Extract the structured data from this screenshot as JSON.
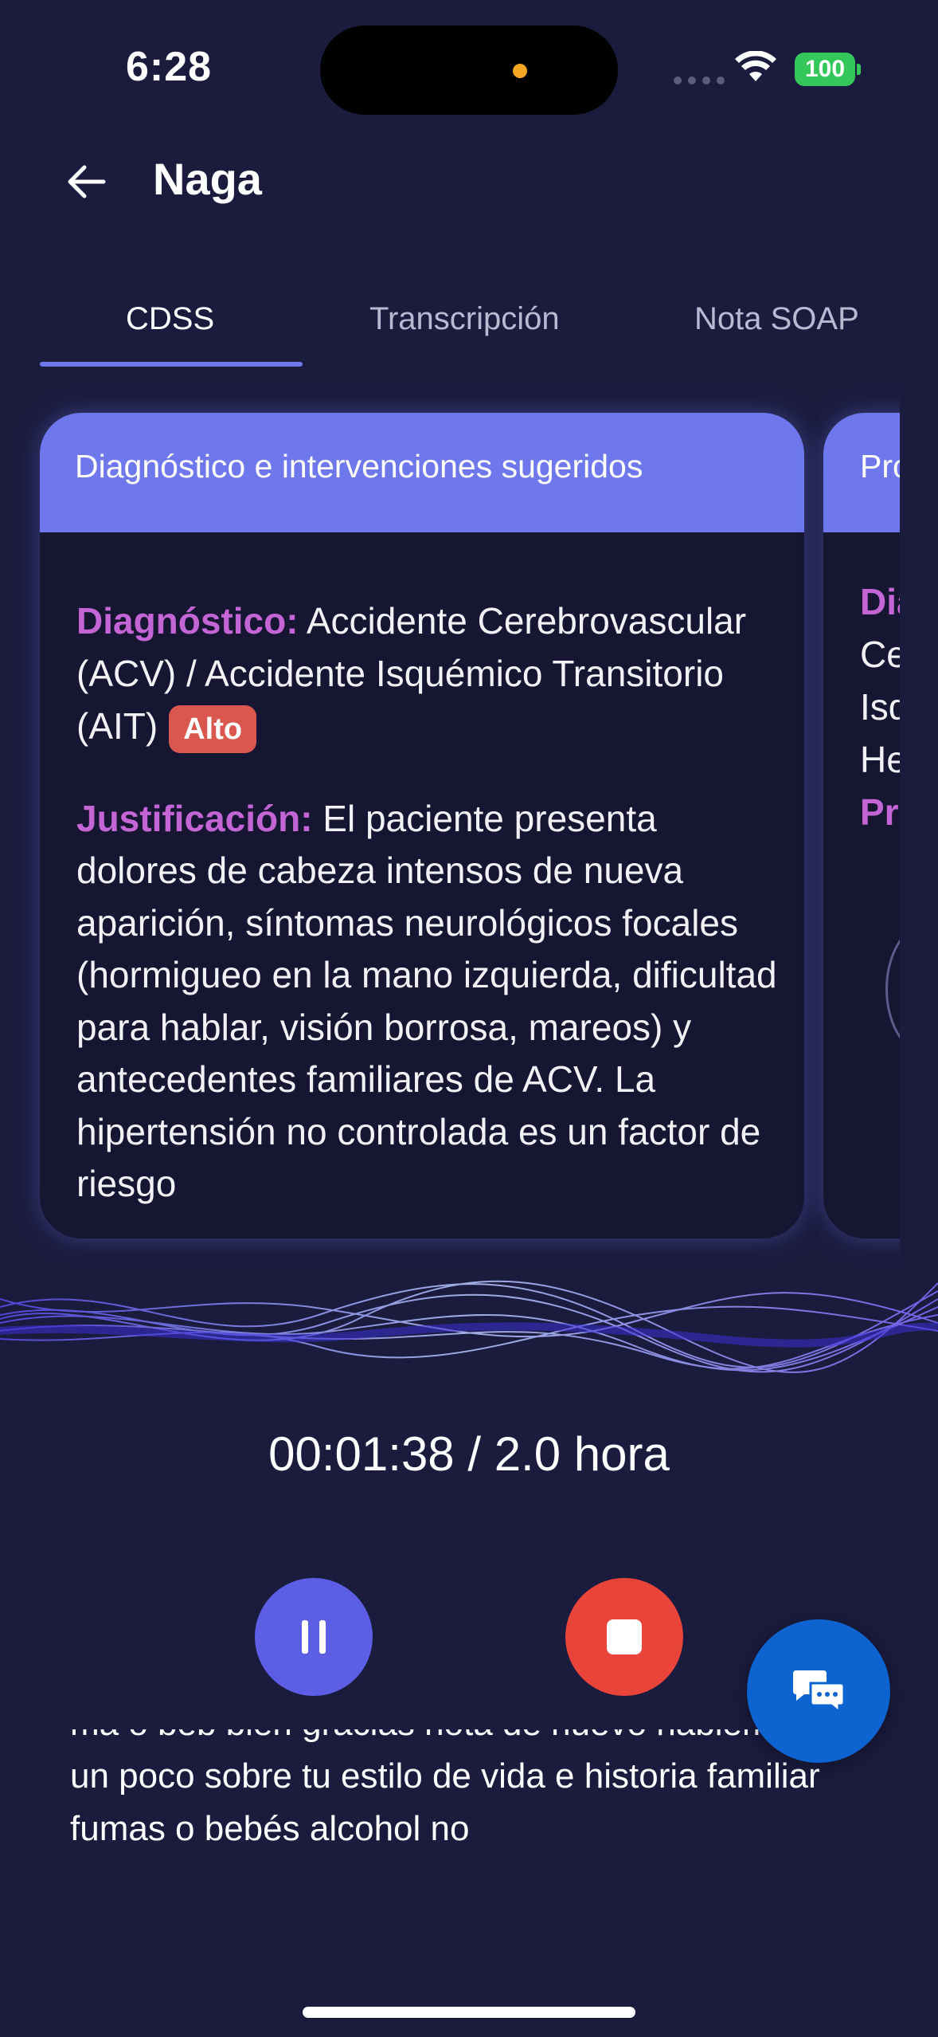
{
  "status_bar": {
    "time": "6:28",
    "battery": "100"
  },
  "header": {
    "title": "Naga"
  },
  "tabs": [
    {
      "label": "CDSS",
      "active": true
    },
    {
      "label": "Transcripción",
      "active": false
    },
    {
      "label": "Nota SOAP",
      "active": false
    }
  ],
  "card": {
    "header": "Diagnóstico e intervenciones sugeridos",
    "diagnosis_label": "Diagnóstico:",
    "diagnosis_text": "Accidente Cerebrovascular (ACV) / Accidente Isquémico Transitorio (AIT)",
    "severity": "Alto",
    "justification_label": "Justificación:",
    "justification_text": "El paciente presenta dolores de cabeza intensos de nueva aparición, síntomas neurológicos focales (hormigueo en la mano izquierda, dificultad para hablar, visión borrosa, mareos) y antecedentes familiares de ACV. La hipertensión no controlada es un factor de riesgo"
  },
  "card2": {
    "header": "Pro",
    "lines": [
      "Dia",
      "Ce",
      "Isq",
      "He",
      "Pr"
    ]
  },
  "recording": {
    "timer": "00:01:38 / 2.0 hora"
  },
  "transcript": {
    "text": "ma  o beb bien gracias nota de nuevo hablemos un poco sobre tu estilo de vida e historia familiar fumas o bebés  alcohol  no"
  },
  "colors": {
    "background": "#1a1b3d",
    "card_header": "#6e78ec",
    "label": "#c365d4",
    "badge": "#d9574f",
    "pause_button": "#5c5fe6",
    "stop_button": "#e8443a",
    "chat_button": "#0d63d0"
  }
}
